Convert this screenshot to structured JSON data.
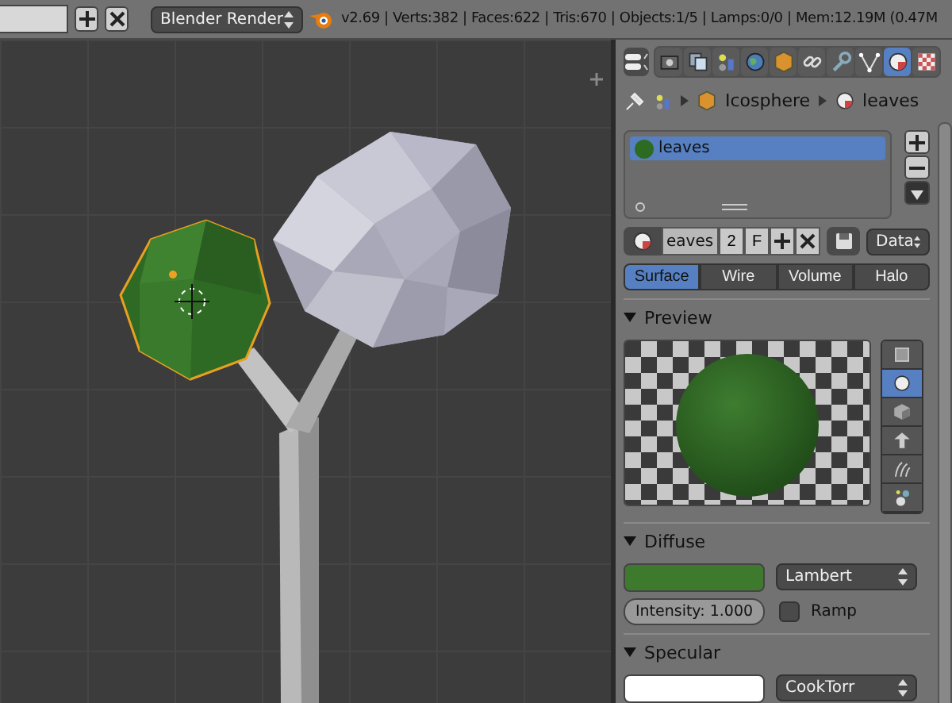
{
  "header": {
    "buttons": [
      {
        "kind": "add"
      },
      {
        "kind": "close"
      }
    ],
    "render_engine": "Blender Render",
    "stats": "v2.69 | Verts:382 | Faces:622 | Tris:670 | Objects:1/5 | Lamps:0/0 | Mem:12.19M (0.47M"
  },
  "properties": {
    "tabs": [
      {
        "kind": "render",
        "selected": false
      },
      {
        "kind": "layers",
        "selected": false
      },
      {
        "kind": "scene",
        "selected": false
      },
      {
        "kind": "world",
        "selected": false
      },
      {
        "kind": "object",
        "selected": false
      },
      {
        "kind": "constraints",
        "selected": false
      },
      {
        "kind": "modifiers",
        "selected": false
      },
      {
        "kind": "data",
        "selected": false
      },
      {
        "kind": "material",
        "selected": true
      },
      {
        "kind": "texture",
        "selected": false
      }
    ],
    "breadcrumb": [
      "Icosphere",
      "leaves"
    ],
    "material_slots": [
      {
        "name": "leaves",
        "selected": true,
        "color": "#2e6b22"
      }
    ],
    "datablock": {
      "name": "eaves",
      "users": "2",
      "fake_user": "F",
      "link": "Data"
    },
    "type_tabs": [
      {
        "label": "Surface",
        "selected": true
      },
      {
        "label": "Wire",
        "selected": false
      },
      {
        "label": "Volume",
        "selected": false
      },
      {
        "label": "Halo",
        "selected": false
      }
    ],
    "preview": {
      "title": "Preview",
      "expanded": true,
      "shapes": [
        {
          "kind": "plane",
          "selected": false
        },
        {
          "kind": "sphere",
          "selected": true
        },
        {
          "kind": "cube",
          "selected": false
        },
        {
          "kind": "monkey",
          "selected": false
        },
        {
          "kind": "hair",
          "selected": false
        },
        {
          "kind": "spheres",
          "selected": false
        }
      ]
    },
    "diffuse": {
      "title": "Diffuse",
      "expanded": true,
      "color": "#3e7a2e",
      "shader": "Lambert",
      "intensity": "Intensity: 1.000",
      "ramp": {
        "label": "Ramp",
        "checked": false
      }
    },
    "specular": {
      "title": "Specular",
      "expanded": true,
      "color": "#ffffff",
      "shader": "CookTorr"
    }
  }
}
